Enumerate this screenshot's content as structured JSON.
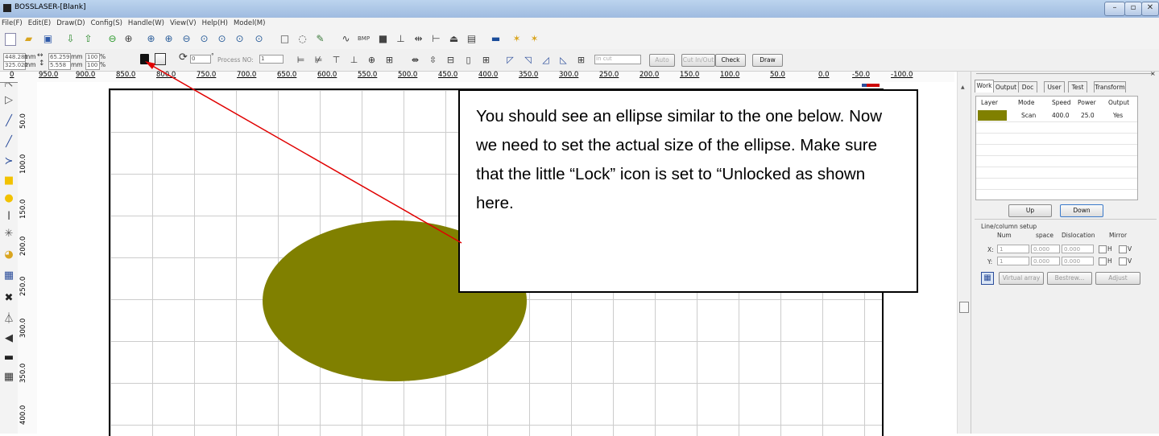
{
  "window": {
    "title": "BOSSLASER-[Blank]",
    "min": "–",
    "max": "▫",
    "close": "✕"
  },
  "menu": [
    "File(F)",
    "Edit(E)",
    "Draw(D)",
    "Config(S)",
    "Handle(W)",
    "View(V)",
    "Help(H)",
    "Model(M)"
  ],
  "toolbar2": {
    "pos_x": "448.281",
    "pos_y": "325.022",
    "unit": "mm",
    "width": "65.259",
    "height": "5.558",
    "scale_x": "100",
    "scale_y": "100",
    "pct": "%",
    "rotate": "0",
    "deg": "°",
    "process_no_label": "Process NO:",
    "process_no": "1",
    "incut": "In cut",
    "auto": "Auto",
    "cutinout": "Cut In/Out",
    "check": "Check",
    "draw": "Draw"
  },
  "ruler_h": [
    "950.0",
    "900.0",
    "850.0",
    "800.0",
    "750.0",
    "700.0",
    "650.0",
    "600.0",
    "550.0",
    "500.0",
    "450.0",
    "400.0",
    "350.0",
    "300.0",
    "250.0",
    "200.0",
    "150.0",
    "100.0",
    "50.0",
    "0.0",
    "-50.0",
    "-100.0"
  ],
  "ruler_h_zero": "0",
  "ruler_v": [
    "50.0",
    "100.0",
    "150.0",
    "200.0",
    "250.0",
    "300.0",
    "350.0",
    "400.0"
  ],
  "callout": {
    "text": "You should see an ellipse similar to the one below.  Now we need to set the actual size of the ellipse.  Make sure that the little “Lock” icon is set to “Unlocked as shown here."
  },
  "panel": {
    "tabs": [
      "Work",
      "Output",
      "Doc",
      "User",
      "Test",
      "Transform"
    ],
    "table_headers": [
      "Layer",
      "Mode",
      "Speed",
      "Power",
      "Output"
    ],
    "rows": [
      {
        "color": "#808000",
        "mode": "Scan",
        "speed": "400.0",
        "power": "25.0",
        "output": "Yes"
      }
    ],
    "up": "Up",
    "down": "Down",
    "line_col_setup": "Line/column setup",
    "col_num": "Num",
    "col_space": "space",
    "col_dislocation": "Dislocation",
    "col_mirror": "Mirror",
    "x_label": "X:",
    "y_label": "Y:",
    "x_num": "1",
    "y_num": "1",
    "x_space": "0.000",
    "y_space": "0.000",
    "x_disl": "0.000",
    "y_disl": "0.000",
    "mirror_h": "H",
    "mirror_v": "V",
    "virtual_array": "Virtual array",
    "bestrew": "Bestrew...",
    "adjust": "Adjust"
  },
  "colors": {
    "ellipse": "#808000",
    "arrow": "#e00000"
  }
}
